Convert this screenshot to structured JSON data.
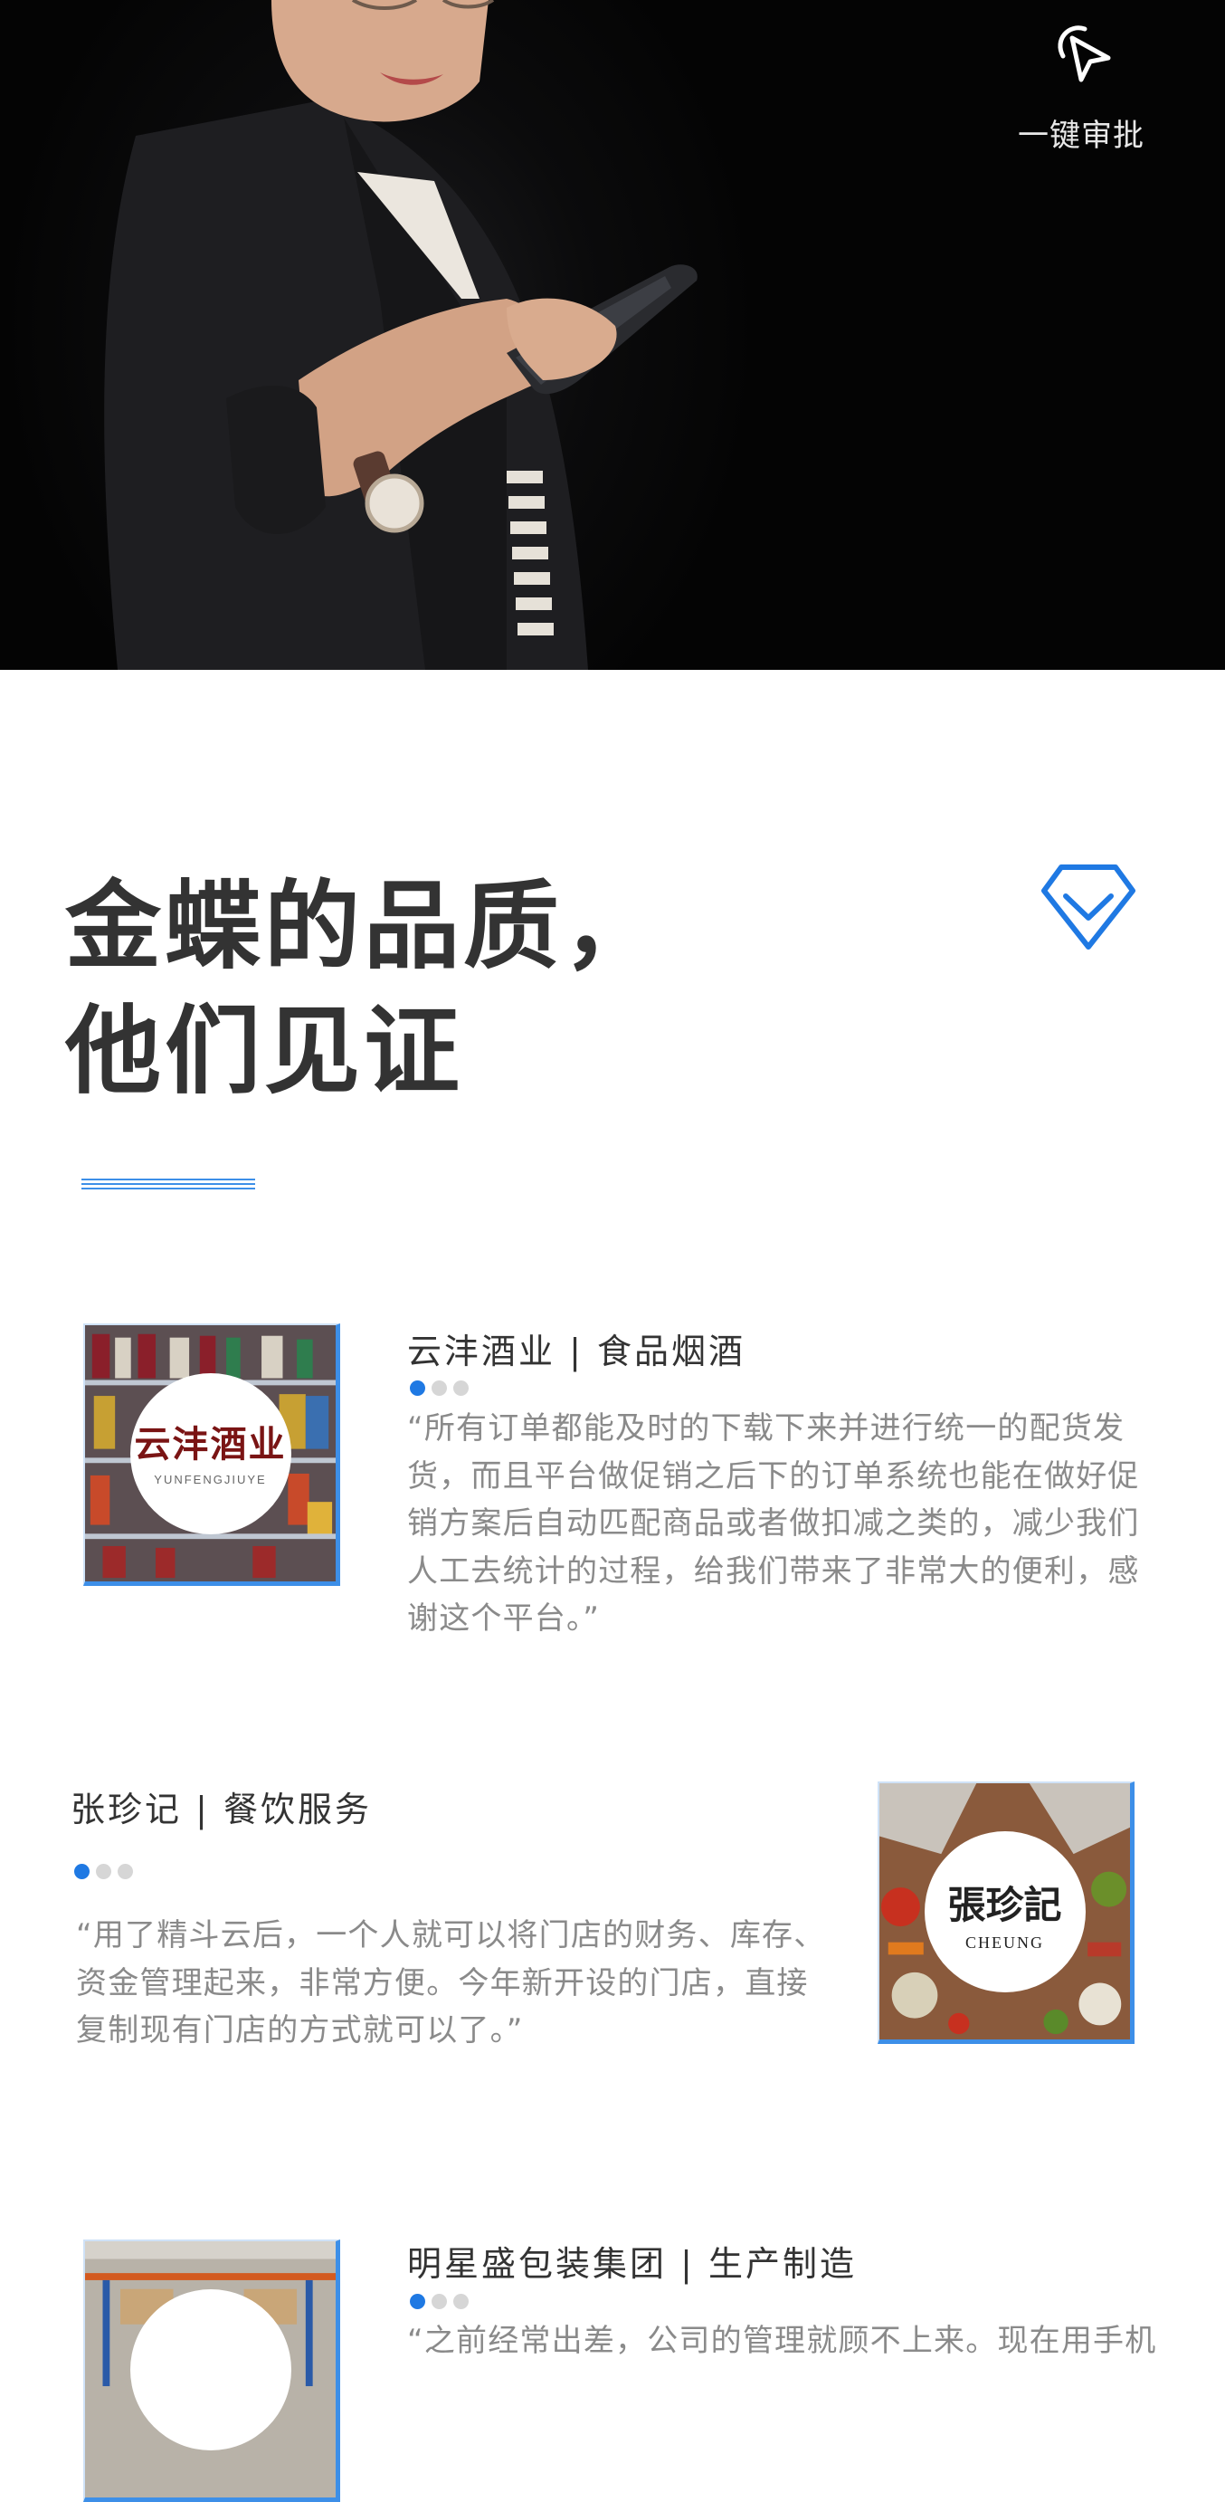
{
  "hero": {
    "approve_label": "一键审批"
  },
  "headline": {
    "line1": "金蝶的品质，",
    "line2": "他们见证"
  },
  "accent_color": "#1f79e3",
  "testimonials": [
    {
      "company": "云沣酒业 | 食品烟酒",
      "logo_text": "云沣酒业",
      "logo_sub": "YUNFENGJIUYE",
      "quote": "“所有订单都能及时的下载下来并进行统一的配货发货，而且平台做促销之后下的订单系统也能在做好促销方案后自动匹配商品或者做扣减之类的，减少我们人工去统计的过程，给我们带来了非常大的便利，感谢这个平台。”"
    },
    {
      "company": "张珍记 | 餐饮服务",
      "logo_text": "張珍記",
      "logo_sub": "CHEUNG",
      "quote": "“用了精斗云后，一个人就可以将门店的财务、库存、资金管理起来，非常方便。今年新开设的门店，直接复制现有门店的方式就可以了。”"
    },
    {
      "company": "明星盛包装集团 | 生产制造",
      "quote": "“之前经常出差，公司的管理就顾不上来。现在用手机"
    }
  ]
}
